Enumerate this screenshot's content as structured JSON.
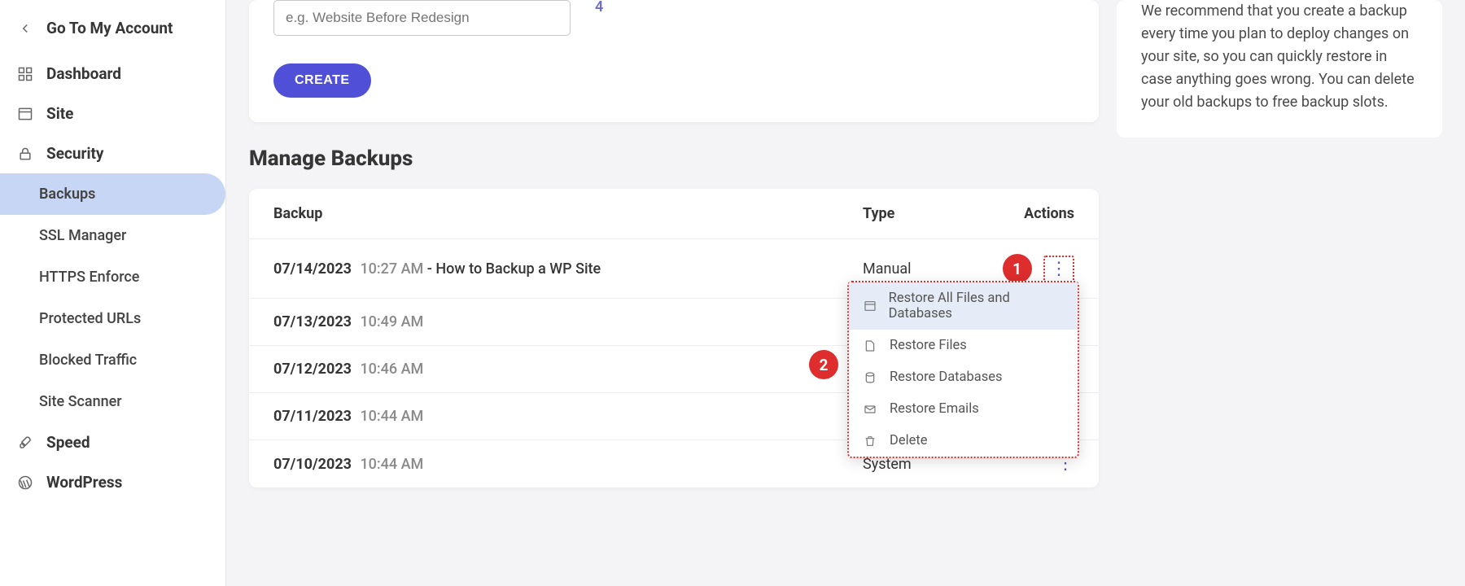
{
  "sidebar": {
    "go_account": "Go To My Account",
    "items": [
      {
        "label": "Dashboard"
      },
      {
        "label": "Site"
      },
      {
        "label": "Security"
      },
      {
        "label": "Speed"
      },
      {
        "label": "WordPress"
      }
    ],
    "security_sub": [
      {
        "label": "Backups"
      },
      {
        "label": "SSL Manager"
      },
      {
        "label": "HTTPS Enforce"
      },
      {
        "label": "Protected URLs"
      },
      {
        "label": "Blocked Traffic"
      },
      {
        "label": "Site Scanner"
      }
    ]
  },
  "create": {
    "placeholder": "e.g. Website Before Redesign",
    "count": "4",
    "button": "CREATE"
  },
  "info_text": "We recommend that you create a backup every time you plan to deploy changes on your site, so you can quickly restore in case anything goes wrong. You can delete your old backups to free backup slots.",
  "manage_title": "Manage Backups",
  "table": {
    "headers": {
      "backup": "Backup",
      "type": "Type",
      "actions": "Actions"
    },
    "rows": [
      {
        "date": "07/14/2023",
        "time": "10:27 AM",
        "sep": " - ",
        "desc": "How to Backup a WP Site",
        "type": "Manual"
      },
      {
        "date": "07/13/2023",
        "time": "10:49 AM",
        "sep": "",
        "desc": "",
        "type": ""
      },
      {
        "date": "07/12/2023",
        "time": "10:46 AM",
        "sep": "",
        "desc": "",
        "type": ""
      },
      {
        "date": "07/11/2023",
        "time": "10:44 AM",
        "sep": "",
        "desc": "",
        "type": ""
      },
      {
        "date": "07/10/2023",
        "time": "10:44 AM",
        "sep": "",
        "desc": "",
        "type": "System"
      }
    ]
  },
  "dropdown": [
    "Restore All Files and Databases",
    "Restore Files",
    "Restore Databases",
    "Restore Emails",
    "Delete"
  ],
  "badges": {
    "one": "1",
    "two": "2"
  }
}
